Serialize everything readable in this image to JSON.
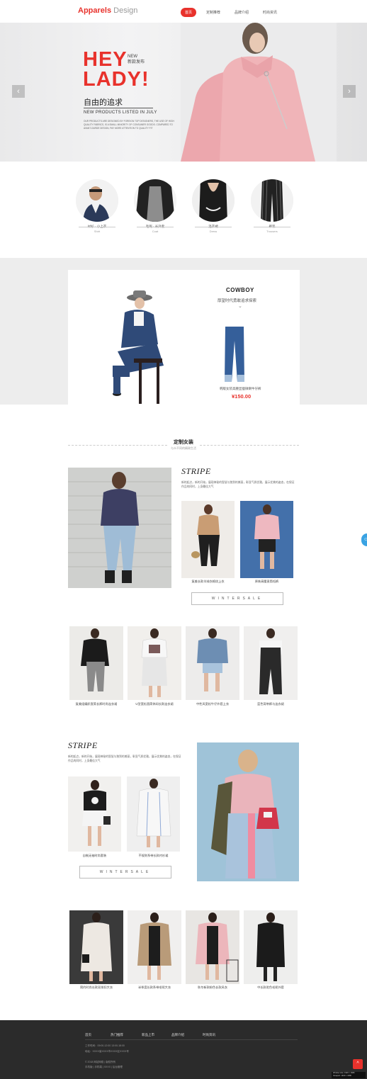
{
  "header": {
    "logo_a": "Apparels",
    "logo_b": "Design",
    "nav": [
      "首页",
      "定制推荐",
      "品牌介绍",
      "时尚资讯"
    ]
  },
  "banner": {
    "headline_1": "HEY",
    "headline_2": "LADY!",
    "new_en": "NEW",
    "new_cn": "新款发布",
    "pursuit": "自由的追求",
    "new_products": "NEW PRODUCTS LISTED IN JULY",
    "desc": "OUR PRODUCTS ARE DESIGNED BY FOREIGN TOP DESIGNERS, THE USE OF HIGH QUALITY FABRICS, IS A SMALL MINORITY OF CONSUMER GOODS. COMPARED TO AVANT-GARDE DESIGN, PAY MORE ATTENTION TO QUALITY FIT",
    "prev": "‹",
    "next": "›"
  },
  "categories": [
    {
      "cn": "衬衫 · 小上衣",
      "en": "Shirt"
    },
    {
      "cn": "毛呢 · 长外套",
      "en": "Coat"
    },
    {
      "cn": "连衣裙",
      "en": "Dress"
    },
    {
      "cn": "裤装",
      "en": "Trousers"
    }
  ],
  "promo": {
    "title": "COWBOY",
    "subtitle": "厚望时代勇敢追求探索",
    "chevron": "⌄",
    "product": "韩版女装高腰显瘦微喇牛仔裤",
    "price": "¥150.00"
  },
  "section": {
    "title": "定制女装",
    "subtitle": "与众不同的精致生活"
  },
  "stripe_1": {
    "title": "STRIPE",
    "desc": "新的起点，新的开始，展现神秘的智慧与独到的美丽，彰显气质优雅，展示优美的姿态，在保证作品的同时，上身最佳大气",
    "items": [
      "复美长款羊绒衣格纹上衣",
      "原装高腰直筒短裤"
    ],
    "button": "WINTERSALE"
  },
  "grid_1": [
    "复美组编织直筒长裤时尚连衣裙",
    "U型宽松直筒休闲长款连衣裙",
    "中性风宽松牛仔外套上衣",
    "蓝色背带裤与连衣裙"
  ],
  "stripe_2": {
    "title": "STRIPE",
    "desc": "新的起点，新的开始，展现神秘的智慧与独到的美丽，彰显气质优雅，展示优美的姿态，在保证作品的同时，上身最佳大气",
    "items": [
      "自制无袖时尚套装",
      "不规则系带长款衬衫裙"
    ],
    "button": "WINTERSALE"
  },
  "grid_2": [
    "简约时尚长款双排扣大衣",
    "半季度长款系带毛呢大衣",
    "秋冬新款粉色长款风衣",
    "中长款驼色毛呢外套"
  ],
  "footer": {
    "nav": [
      "首页",
      "热门推荐",
      "新品上市",
      "品牌介绍",
      "时尚资讯"
    ],
    "hours": "工作时间：09:00-12:00  13:00-18:00",
    "address": "地址：XXXX省XXXX市XXXX区XXXX号",
    "copyright": "© 2018 网站网络 | 版权所有",
    "phone": "手机版 | 手机端 | XXXX | 后台管理",
    "totop": "^",
    "badge_1": "Window size: 1920 × 1680",
    "badge_2": "Viewport: 1920 × 1680"
  },
  "side": {
    "chat": "☺"
  }
}
